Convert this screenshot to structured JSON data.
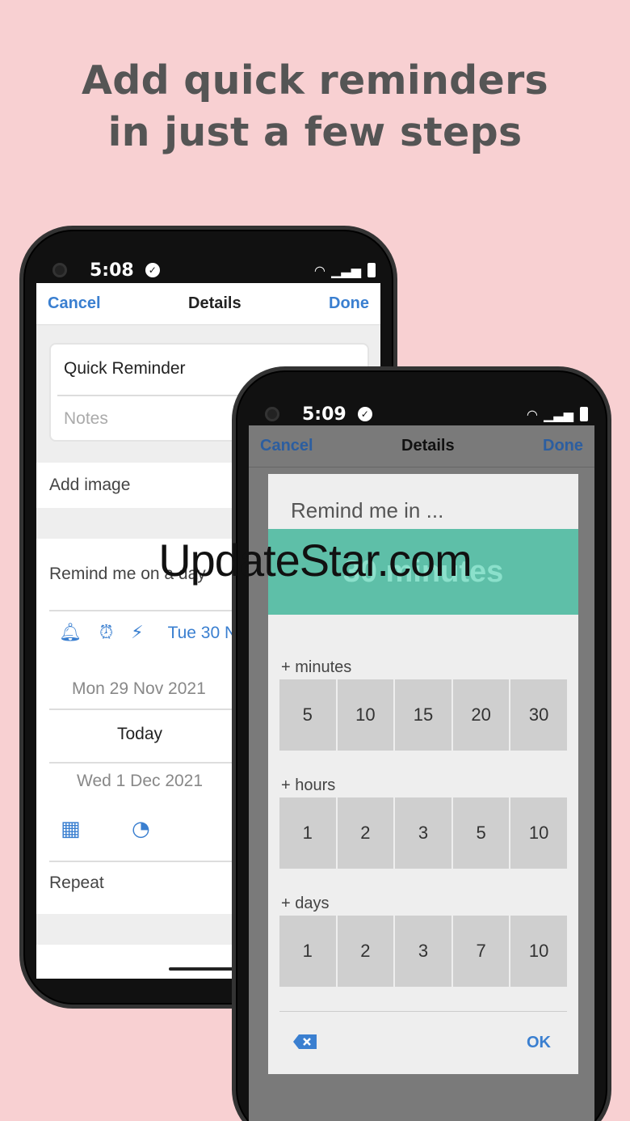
{
  "headline": {
    "line1": "Add quick reminders",
    "line2": "in just a few steps"
  },
  "phone1": {
    "status": {
      "time": "5:08"
    },
    "nav": {
      "cancel": "Cancel",
      "title": "Details",
      "done": "Done"
    },
    "title_value": "Quick Reminder",
    "notes_placeholder": "Notes",
    "add_image": "Add image",
    "remind_label": "Remind me on a day",
    "date_chip": "Tue 30 N",
    "date_prev": "Mon 29 Nov 2021",
    "date_today": "Today",
    "date_next": "Wed 1 Dec 2021",
    "repeat": "Repeat"
  },
  "phone2": {
    "status": {
      "time": "5:09"
    },
    "nav": {
      "cancel": "Cancel",
      "title": "Details",
      "done": "Done"
    },
    "dialog": {
      "title": "Remind me in ...",
      "banner": "30 minutes",
      "minutes_label": "+ minutes",
      "minutes": [
        "5",
        "10",
        "15",
        "20",
        "30"
      ],
      "hours_label": "+ hours",
      "hours": [
        "1",
        "2",
        "3",
        "5",
        "10"
      ],
      "days_label": "+ days",
      "days": [
        "1",
        "2",
        "3",
        "7",
        "10"
      ],
      "ok": "OK"
    }
  },
  "watermark": "UpdateStar.com",
  "colors": {
    "background": "#f8d0d2",
    "accent": "#3a7fd0",
    "banner": "#5ebfa8"
  }
}
